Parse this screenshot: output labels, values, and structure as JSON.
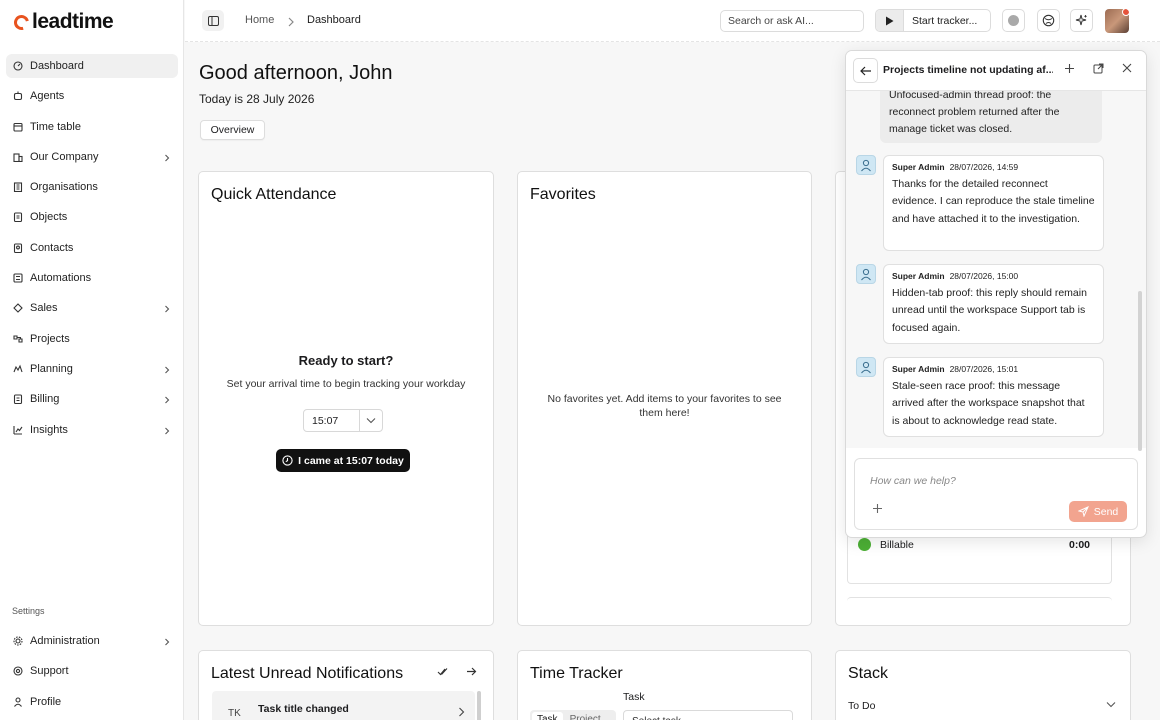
{
  "app": {
    "logo_text": "leadtime",
    "brand_color": "#e8531f"
  },
  "sidebar": {
    "items": [
      {
        "label": "Dashboard",
        "icon": "dashboard-icon",
        "active": true,
        "chevron": false
      },
      {
        "label": "Agents",
        "icon": "agents-icon",
        "chevron": false
      },
      {
        "label": "Time table",
        "icon": "calendar-icon",
        "chevron": false
      },
      {
        "label": "Our Company",
        "icon": "company-icon",
        "chevron": true
      },
      {
        "label": "Organisations",
        "icon": "organisations-icon",
        "chevron": false
      },
      {
        "label": "Objects",
        "icon": "objects-icon",
        "chevron": false
      },
      {
        "label": "Contacts",
        "icon": "contacts-icon",
        "chevron": false
      },
      {
        "label": "Automations",
        "icon": "automations-icon",
        "chevron": false
      },
      {
        "label": "Sales",
        "icon": "sales-icon",
        "chevron": true
      },
      {
        "label": "Projects",
        "icon": "projects-icon",
        "chevron": false
      },
      {
        "label": "Planning",
        "icon": "planning-icon",
        "chevron": true
      },
      {
        "label": "Billing",
        "icon": "billing-icon",
        "chevron": true
      },
      {
        "label": "Insights",
        "icon": "insights-icon",
        "chevron": true
      }
    ],
    "settings_label": "Settings",
    "bottom_items": [
      {
        "label": "Administration",
        "icon": "administration-icon",
        "chevron": true
      },
      {
        "label": "Support",
        "icon": "support-icon",
        "chevron": false
      },
      {
        "label": "Profile",
        "icon": "profile-icon",
        "chevron": false
      }
    ]
  },
  "topbar": {
    "breadcrumb_home": "Home",
    "breadcrumb_current": "Dashboard",
    "search_placeholder": "Search or ask AI...",
    "tracker_label": "Start tracker..."
  },
  "main": {
    "greeting": "Good afternoon, John",
    "date_text": "Today is 28 July 2026",
    "tab_overview": "Overview"
  },
  "quick_attendance": {
    "title": "Quick Attendance",
    "ready": "Ready to start?",
    "hint": "Set your arrival time to begin tracking your workday",
    "time_value": "15:07",
    "button_label": "I came at 15:07 today"
  },
  "favorites": {
    "title": "Favorites",
    "empty_text": "No favorites yet. Add items to your favorites to see them here!"
  },
  "third_card": {
    "billable_label": "Billable",
    "billable_value": "0:00",
    "billable_color": "#4caf35"
  },
  "notifications": {
    "title": "Latest Unread Notifications",
    "row_initials": "TK",
    "row_title": "Task title changed"
  },
  "time_tracker": {
    "title": "Time Tracker",
    "task_label": "Task",
    "seg_task": "Task",
    "seg_project": "Project",
    "select_placeholder": "Select task"
  },
  "stack": {
    "title": "Stack",
    "todo_label": "To Do"
  },
  "chat": {
    "title": "Projects timeline not updating af...",
    "first_bubble": "Unfocused-admin thread proof: the reconnect problem returned after the manage ticket was closed.",
    "messages": [
      {
        "author": "Super Admin",
        "time": "28/07/2026, 14:59",
        "text": "Thanks for the detailed reconnect evidence. I can reproduce the stale timeline and have attached it to the investigation."
      },
      {
        "author": "Super Admin",
        "time": "28/07/2026, 15:00",
        "text": "Hidden-tab proof: this reply should remain unread until the workspace Support tab is focused again."
      },
      {
        "author": "Super Admin",
        "time": "28/07/2026, 15:01",
        "text": "Stale-seen race proof: this message arrived after the workspace snapshot that is about to acknowledge read state."
      }
    ],
    "input_placeholder": "How can we help?",
    "send_label": "Send",
    "send_color": "#f2a48f"
  }
}
